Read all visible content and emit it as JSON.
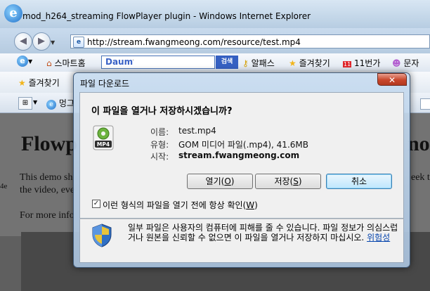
{
  "window": {
    "title": "mod_h264_streaming FlowPlayer plugin - Windows Internet Explorer",
    "url": "http://stream.fwangmeong.com/resource/test.mp4"
  },
  "toolbar1": {
    "home_label": "스마트홈",
    "search_brand": "Daum",
    "search_button": "검색",
    "alpass_label": "알패스",
    "favorites_label": "즐겨찾기",
    "11st_label": "11번가",
    "sms_label": "문자"
  },
  "toolbar2": {
    "favorites_label": "즐겨찾기"
  },
  "toolbar3": {
    "tab_label": "멍그"
  },
  "page": {
    "heading_left": "Flowp",
    "heading_right": "no",
    "para1_left": "This demo sh",
    "para1_right": "eek to",
    "para2": "the video, eve",
    "para3": "For more info",
    "side_text": "4e"
  },
  "dialog": {
    "title": "파일 다운로드",
    "close": "✕",
    "question": "이 파일을 열거나 저장하시겠습니까?",
    "icon_label": "MP4",
    "name_label": "이름:",
    "name_value": "test.mp4",
    "type_label": "유형:",
    "type_value": "GOM 미디어 파일(.mp4), 41.6MB",
    "from_label": "시작:",
    "from_value": "stream.fwangmeong.com",
    "open_button": "열기(",
    "open_key": "O",
    "save_button": "저장(",
    "save_key": "S",
    "cancel_button": "취소",
    "button_suffix": ")",
    "checkbox_checked": true,
    "checkbox_mark": "✓",
    "checkbox_label": "이런 형식의 파일을 열기 전에 항상 확인(",
    "checkbox_key": "W",
    "warning_text": "일부 파일은 사용자의 컴퓨터에 피해를 줄 수 있습니다. 파일 정보가 의심스럽거나 원본을 신뢰할 수 없으면 이 파일을 열거나 저장하지 마십시오.",
    "warning_link": "위험성"
  },
  "colors": {
    "chrome_blue": "#c9dbee",
    "dialog_face": "#f0f0f0",
    "close_red": "#c8462b",
    "link_blue": "#0645ad"
  }
}
